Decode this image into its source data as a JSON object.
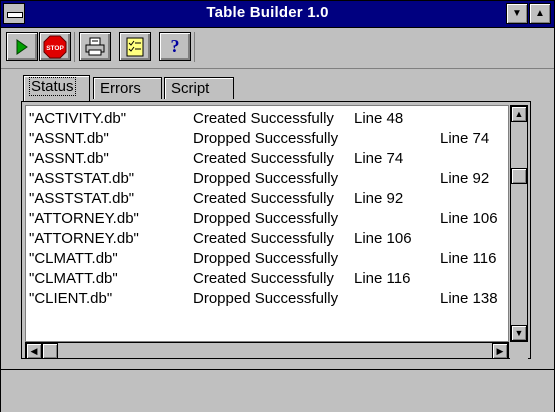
{
  "window": {
    "title": "Table Builder 1.0",
    "controls": {
      "system_menu": "system-menu-icon",
      "minimize": "▼",
      "maximize": "▲"
    }
  },
  "toolbar": {
    "buttons": [
      {
        "name": "run",
        "icon": "play-icon",
        "color": "#00a000"
      },
      {
        "name": "stop",
        "icon": "stop-sign-icon",
        "label": "STOP",
        "color": "#e00000"
      },
      {
        "name": "print",
        "icon": "printer-icon"
      },
      {
        "name": "checklist",
        "icon": "checklist-icon",
        "color": "#ffff80"
      },
      {
        "name": "help",
        "icon": "help-icon",
        "label": "?"
      }
    ]
  },
  "tabs": [
    {
      "label": "Status",
      "active": true
    },
    {
      "label": "Errors",
      "active": false
    },
    {
      "label": "Script",
      "active": false
    }
  ],
  "log": {
    "rows": [
      {
        "file": "\"ACTIVITY.db\"",
        "status": "Created Successfully",
        "line": "Line 48",
        "style": "created"
      },
      {
        "file": "\"ASSNT.db\"",
        "status": "Dropped Successfully",
        "line": "Line 74",
        "style": "dropped"
      },
      {
        "file": "\"ASSNT.db\"",
        "status": "Created Successfully",
        "line": "Line 74",
        "style": "created"
      },
      {
        "file": "\"ASSTSTAT.db\"",
        "status": "Dropped Successfully",
        "line": "Line 92",
        "style": "dropped"
      },
      {
        "file": "\"ASSTSTAT.db\"",
        "status": "Created Successfully",
        "line": "Line 92",
        "style": "created"
      },
      {
        "file": "\"ATTORNEY.db\"",
        "status": "Dropped Successfully",
        "line": "Line 106",
        "style": "dropped"
      },
      {
        "file": "\"ATTORNEY.db\"",
        "status": "Created Successfully",
        "line": "Line 106",
        "style": "created"
      },
      {
        "file": "\"CLMATT.db\"",
        "status": "Dropped Successfully",
        "line": "Line 116",
        "style": "dropped"
      },
      {
        "file": "\"CLMATT.db\"",
        "status": "Created Successfully",
        "line": "Line 116",
        "style": "created"
      },
      {
        "file": "\"CLIENT.db\"",
        "status": "Dropped Successfully",
        "line": "Line 138",
        "style": "dropped"
      }
    ]
  },
  "scrollbars": {
    "up_arrow": "▲",
    "down_arrow": "▼",
    "left_arrow": "◀",
    "right_arrow": "▶"
  },
  "statusbar": {
    "text": ""
  }
}
